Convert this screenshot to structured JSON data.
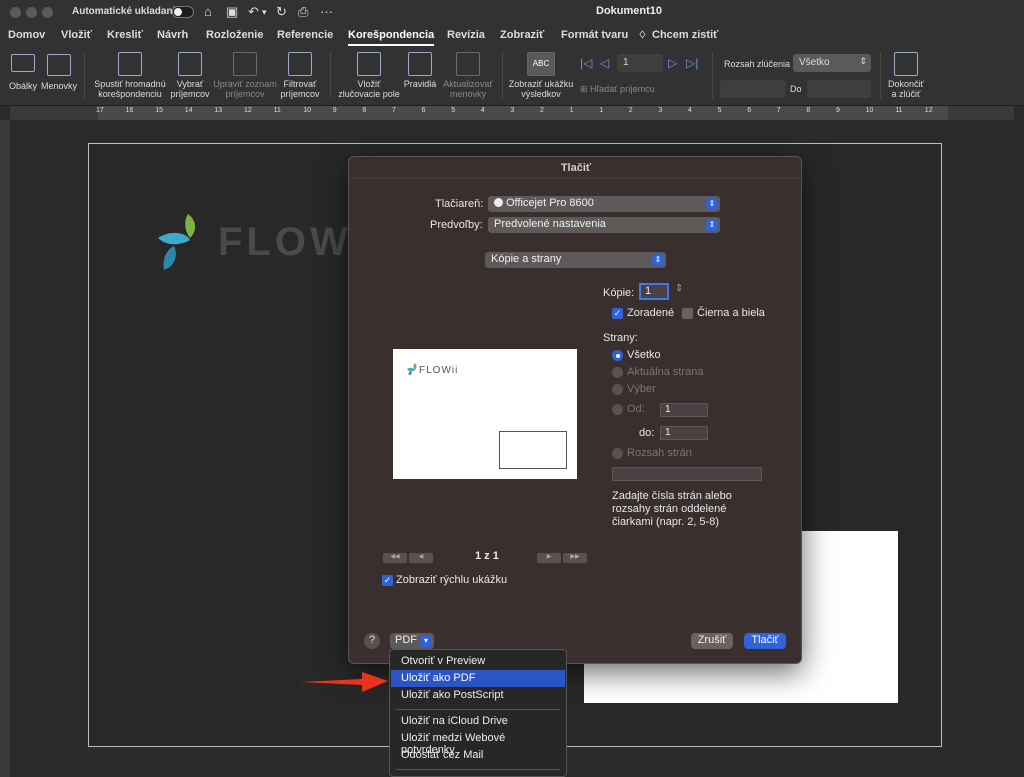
{
  "titlebar": {
    "autosave_label": "Automatické ukladanie",
    "document_title": "Dokument10"
  },
  "tabs": [
    "Domov",
    "Vložiť",
    "Kresliť",
    "Návrh",
    "Rozloženie",
    "Referencie",
    "Korešpondencia",
    "Revízia",
    "Zobraziť",
    "Formát tvaru",
    "Chcem zistiť"
  ],
  "active_tab": "Korešpondencia",
  "ribbon": {
    "envelopes": "Obálky",
    "labels": "Menovky",
    "start_merge_1": "Spustiť hromadnú",
    "start_merge_2": "korešpondenciu",
    "select_recipients_1": "Vybrať",
    "select_recipients_2": "príjemcov",
    "edit_list_1": "Upraviť zoznam",
    "edit_list_2": "príjemcov",
    "filter_1": "Filtrovať",
    "filter_2": "príjemcov",
    "insert_field_1": "Vložiť",
    "insert_field_2": "zlučovacie pole",
    "rules": "Pravidlá",
    "update_labels_1": "Aktualizovať",
    "update_labels_2": "menovky",
    "preview_results_1": "Zobraziť ukážku",
    "preview_results_2": "výsledkov",
    "preview_icon_text": "ABC",
    "record_number": "1",
    "find_recipient": "Hľadať príjemcu",
    "merge_range_label": "Rozsah zlúčenia",
    "merge_range_value": "Všetko",
    "to_label": "Do",
    "finish_merge_1": "Dokončiť",
    "finish_merge_2": "a zlúčiť"
  },
  "ruler_ticks": [
    "17",
    "16",
    "15",
    "14",
    "13",
    "12",
    "11",
    "10",
    "9",
    "8",
    "7",
    "6",
    "5",
    "4",
    "3",
    "2",
    "1",
    "1",
    "2",
    "3",
    "4",
    "5",
    "6",
    "7",
    "8",
    "9",
    "10",
    "11",
    "12"
  ],
  "page": {
    "logo_text": "FLOW"
  },
  "dialog": {
    "title": "Tlačiť",
    "printer_label": "Tlačiareň:",
    "printer_value": "Officejet Pro 8600",
    "presets_label": "Predvoľby:",
    "presets_value": "Predvolené nastavenia",
    "section_value": "Kópie a strany",
    "copies_label": "Kópie:",
    "copies_value": "1",
    "collated_label": "Zoradené",
    "bw_label": "Čierna a biela",
    "pages_label": "Strany:",
    "all_label": "Všetko",
    "current_label": "Aktuálna strana",
    "selection_label": "Výber",
    "from_label": "Od:",
    "from_value": "1",
    "to_label": "do:",
    "to_value": "1",
    "range_label": "Rozsah strán",
    "hint_1": "Zadajte čísla strán alebo",
    "hint_2": "rozsahy strán oddelené",
    "hint_3": "čiarkami (napr. 2, 5-8)",
    "preview_logo": "FLOWii",
    "page_counter": "1 z 1",
    "quick_preview_label": "Zobraziť rýchlu ukážku",
    "help": "?",
    "pdf_button": "PDF",
    "cancel_button": "Zrušiť",
    "print_button": "Tlačiť"
  },
  "pdf_menu": {
    "items": [
      "Otvoriť v Preview",
      "Uložiť ako PDF",
      "Uložiť ako PostScript",
      "Uložiť na iCloud Drive",
      "Uložiť medzi Webové potvrdenky",
      "Odoslať cez Mail"
    ],
    "highlighted": "Uložiť ako PDF"
  },
  "colors": {
    "accent": "#2f63d8",
    "arrow": "#e8341c"
  }
}
